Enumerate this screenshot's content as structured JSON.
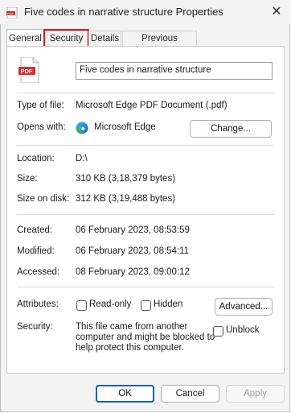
{
  "window": {
    "title": "Five codes in narrative structure Properties",
    "close_glyph": "✕"
  },
  "tabs": [
    {
      "label": "General",
      "active": true
    },
    {
      "label": "Security",
      "highlighted": true
    },
    {
      "label": "Details"
    },
    {
      "label": "Previous Versions"
    }
  ],
  "file_icon_text": "PDF",
  "file_name": "Five codes in narrative structure",
  "type_of_file": {
    "label": "Type of file:",
    "value": "Microsoft Edge PDF Document (.pdf)"
  },
  "opens_with": {
    "label": "Opens with:",
    "value": "Microsoft Edge",
    "change_button": "Change..."
  },
  "location": {
    "label": "Location:",
    "value": "D:\\"
  },
  "size": {
    "label": "Size:",
    "value": "310 KB (3,18,379 bytes)"
  },
  "size_on_disk": {
    "label": "Size on disk:",
    "value": "312 KB (3,19,488 bytes)"
  },
  "created": {
    "label": "Created:",
    "value": "06 February 2023, 08:53:59"
  },
  "modified": {
    "label": "Modified:",
    "value": "06 February 2023, 08:54:11"
  },
  "accessed": {
    "label": "Accessed:",
    "value": "08 February 2023, 09:00:12"
  },
  "attributes": {
    "label": "Attributes:",
    "read_only": "Read-only",
    "hidden": "Hidden",
    "advanced_button": "Advanced..."
  },
  "security": {
    "label": "Security:",
    "message_lines": [
      "This file came from another",
      "computer and might be blocked to",
      "help protect this computer."
    ],
    "unblock": "Unblock"
  },
  "footer": {
    "ok": "OK",
    "cancel": "Cancel",
    "apply": "Apply"
  },
  "colors": {
    "accent": "#005fb8",
    "highlight": "#e01414",
    "pdf_red": "#d32f2f"
  }
}
